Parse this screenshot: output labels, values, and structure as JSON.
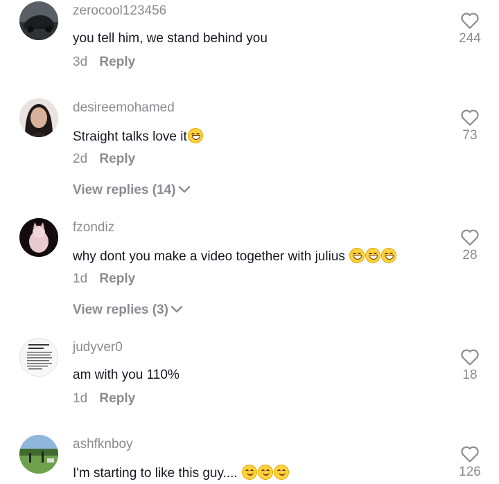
{
  "comments": [
    {
      "username": "zerocool123456",
      "text": "you tell him, we stand behind you",
      "emojis": "",
      "age": "3d",
      "reply_label": "Reply",
      "likes": "244",
      "view_replies": ""
    },
    {
      "username": "desireemohamed",
      "text": "Straight talks love it",
      "emojis": "😁",
      "age": "2d",
      "reply_label": "Reply",
      "likes": "73",
      "view_replies": "View replies (14)"
    },
    {
      "username": "fzondiz",
      "text": "why dont you make a video together with julius ",
      "emojis": "😁😅😂",
      "age": "1d",
      "reply_label": "Reply",
      "likes": "28",
      "view_replies": "View replies (3)"
    },
    {
      "username": "judyver0",
      "text": "am with you 110%",
      "emojis": "",
      "age": "1d",
      "reply_label": "Reply",
      "likes": "18",
      "view_replies": ""
    },
    {
      "username": "ashfknboy",
      "text": "I'm starting to like this guy.... ",
      "emojis": "😏😏😏",
      "age": "",
      "reply_label": "",
      "likes": "126",
      "view_replies": ""
    }
  ],
  "icons": {
    "like": "heart-outline-icon",
    "expand": "chevron-down-icon"
  },
  "colors": {
    "text": "#161823",
    "muted": "#8a8b91",
    "emoji": "#ffd23e"
  }
}
